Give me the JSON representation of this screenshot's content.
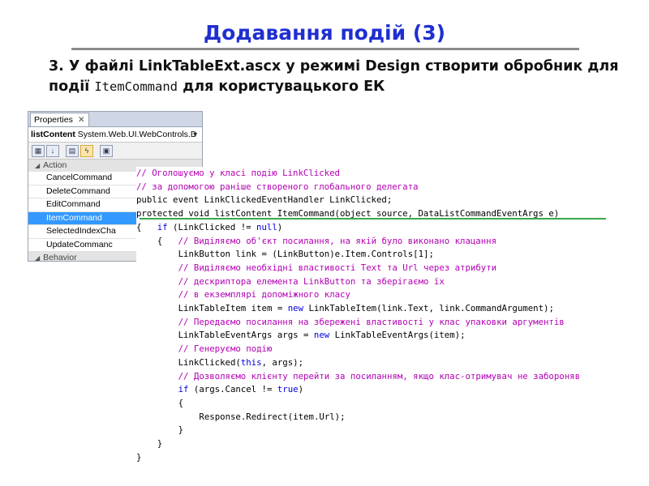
{
  "title": "Додавання подій (3)",
  "subtitle": {
    "prefix": "3. У файлі LinkTableExt.ascx у режимі Design створити обробник для події ",
    "code": "ItemCommand",
    "suffix": " для користувацького ЕК"
  },
  "properties_panel": {
    "tab_label": "Properties",
    "tab_close": "✕",
    "object_name": "listContent",
    "object_type": "System.Web.UI.WebControls.D",
    "category": "Action",
    "next_category": "Behavior",
    "items": [
      "CancelCommand",
      "DeleteCommand",
      "EditCommand",
      "ItemCommand",
      "SelectedIndexCha",
      "UpdateCommanc"
    ],
    "selected_item": "ItemCommand"
  },
  "code_lines": [
    {
      "indent": 0,
      "parts": [
        {
          "t": "// Оголошуємо у класі подію LinkClicked",
          "c": "cm"
        }
      ]
    },
    {
      "indent": 0,
      "parts": [
        {
          "t": "// за допомогою раніше створеного глобального делегата",
          "c": "cm"
        }
      ]
    },
    {
      "indent": 0,
      "parts": [
        {
          "t": "public event LinkClickedEventHandler LinkClicked;",
          "c": ""
        }
      ]
    },
    {
      "indent": 0,
      "parts": [
        {
          "t": "protected void listContent_ItemCommand(object source, DataListCommandEventArgs e)",
          "c": ""
        }
      ]
    },
    {
      "indent": 0,
      "parts": [
        {
          "t": "{   ",
          "c": ""
        },
        {
          "t": "if",
          "c": "kw"
        },
        {
          "t": " (LinkClicked != ",
          "c": ""
        },
        {
          "t": "null",
          "c": "kw"
        },
        {
          "t": ")",
          "c": ""
        }
      ]
    },
    {
      "indent": 4,
      "parts": [
        {
          "t": "{   ",
          "c": ""
        },
        {
          "t": "// Виділяємо об'єкт посилання, на якій було виконано клацання",
          "c": "cm"
        }
      ]
    },
    {
      "indent": 8,
      "parts": [
        {
          "t": "LinkButton link = (LinkButton)e.Item.Controls[1];",
          "c": ""
        }
      ]
    },
    {
      "indent": 8,
      "parts": [
        {
          "t": "// Виділяємо необхідні властивості Text та Url через атрибути",
          "c": "cm"
        }
      ]
    },
    {
      "indent": 8,
      "parts": [
        {
          "t": "// дескриптора елемента LinkButton та зберігаємо їх",
          "c": "cm"
        }
      ]
    },
    {
      "indent": 8,
      "parts": [
        {
          "t": "// в екземплярі допоміжного класу",
          "c": "cm"
        }
      ]
    },
    {
      "indent": 8,
      "parts": [
        {
          "t": "LinkTableItem item = ",
          "c": ""
        },
        {
          "t": "new",
          "c": "kw"
        },
        {
          "t": " LinkTableItem(link.Text, link.CommandArgument);",
          "c": ""
        }
      ]
    },
    {
      "indent": 8,
      "parts": [
        {
          "t": "// Передаємо посилання на збережені властивості у клас упаковки аргументів",
          "c": "cm"
        }
      ]
    },
    {
      "indent": 8,
      "parts": [
        {
          "t": "LinkTableEventArgs args = ",
          "c": ""
        },
        {
          "t": "new",
          "c": "kw"
        },
        {
          "t": " LinkTableEventArgs(item);",
          "c": ""
        }
      ]
    },
    {
      "indent": 8,
      "parts": [
        {
          "t": "// Генеруємо подію",
          "c": "cm"
        }
      ]
    },
    {
      "indent": 8,
      "parts": [
        {
          "t": "LinkClicked(",
          "c": ""
        },
        {
          "t": "this",
          "c": "kw"
        },
        {
          "t": ", args);",
          "c": ""
        }
      ]
    },
    {
      "indent": 8,
      "parts": [
        {
          "t": "// Дозволяємо клієнту перейти за посиланням, якщо клас-отримувач не забороняв",
          "c": "cm"
        }
      ]
    },
    {
      "indent": 8,
      "parts": [
        {
          "t": "if",
          "c": "kw"
        },
        {
          "t": " (args.Cancel != ",
          "c": ""
        },
        {
          "t": "true",
          "c": "kw"
        },
        {
          "t": ")",
          "c": ""
        }
      ]
    },
    {
      "indent": 8,
      "parts": [
        {
          "t": "{",
          "c": ""
        }
      ]
    },
    {
      "indent": 12,
      "parts": [
        {
          "t": "Response.Redirect(item.Url);",
          "c": ""
        }
      ]
    },
    {
      "indent": 8,
      "parts": [
        {
          "t": "}",
          "c": ""
        }
      ]
    },
    {
      "indent": 4,
      "parts": [
        {
          "t": "}",
          "c": ""
        }
      ]
    },
    {
      "indent": 0,
      "parts": [
        {
          "t": "}",
          "c": ""
        }
      ]
    }
  ]
}
